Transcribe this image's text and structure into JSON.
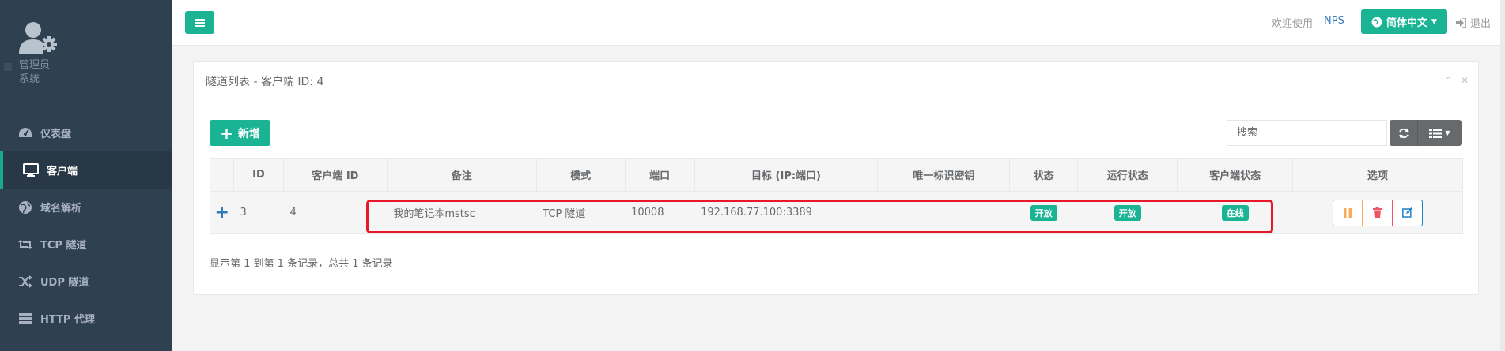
{
  "sidebar": {
    "profile": {
      "name": "管理员",
      "role": "系统"
    },
    "items": [
      {
        "label": "仪表盘",
        "icon": "dashboard-icon"
      },
      {
        "label": "客户端",
        "icon": "desktop-icon",
        "active": true
      },
      {
        "label": "域名解析",
        "icon": "globe-icon"
      },
      {
        "label": "TCP 隧道",
        "icon": "retweet-icon"
      },
      {
        "label": "UDP 隧道",
        "icon": "random-icon"
      },
      {
        "label": "HTTP 代理",
        "icon": "server-icon"
      }
    ]
  },
  "topbar": {
    "welcome": "欢迎使用",
    "brand": "NPS",
    "language": "简体中文",
    "logout": "退出"
  },
  "panel": {
    "title": "隧道列表 - 客户端 ID: 4",
    "add_label": "新增",
    "search_placeholder": "搜索",
    "columns": [
      "ID",
      "客户端 ID",
      "备注",
      "模式",
      "端口",
      "目标 (IP:端口)",
      "唯一标识密钥",
      "状态",
      "运行状态",
      "客户端状态",
      "选项"
    ],
    "rows": [
      {
        "expand": "+",
        "id": "3",
        "client_id": "4",
        "remark": "我的笔记本mstsc",
        "mode": "TCP 隧道",
        "port": "10008",
        "target": "192.168.77.100:3389",
        "key": "",
        "status": "开放",
        "run_status": "开放",
        "client_status": "在线"
      }
    ],
    "pagination_info": "显示第 1 到第 1 条记录，总共 1 条记录"
  },
  "colors": {
    "sidebar_bg": "#2f4050",
    "accent": "#1ab394",
    "highlight": "#e8182a"
  }
}
